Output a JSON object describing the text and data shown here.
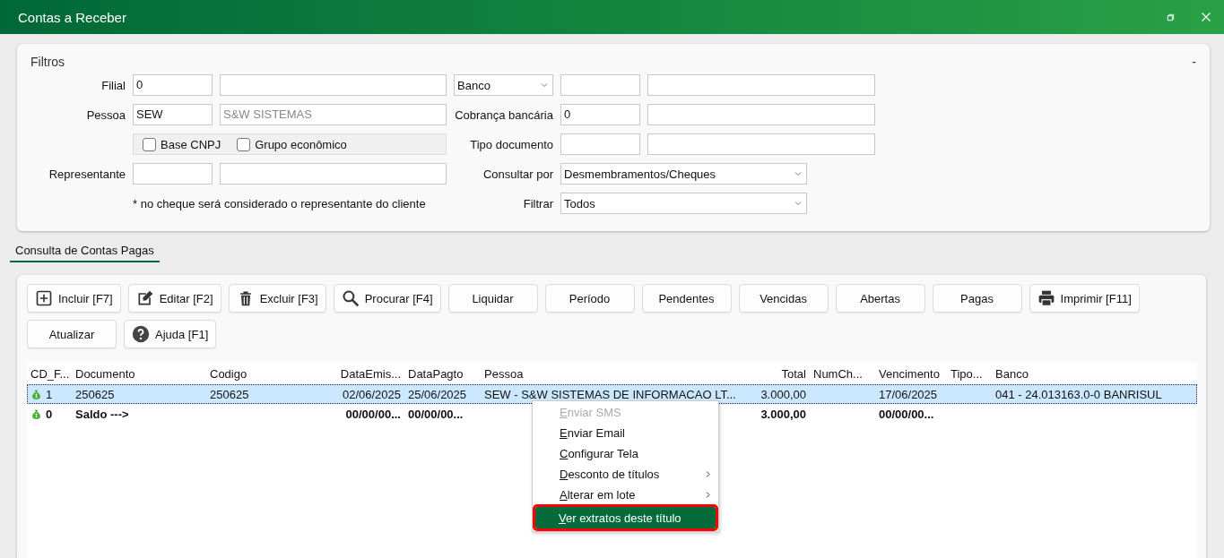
{
  "window": {
    "title": "Contas a Receber"
  },
  "filters": {
    "title": "Filtros",
    "collapse": "-",
    "left": [
      {
        "kind": "pair",
        "label": "Filial",
        "code": "0"
      },
      {
        "kind": "pair",
        "label": "Pessoa",
        "code": "SEW",
        "name": "S&W SISTEMAS",
        "name_readonly": true
      },
      {
        "kind": "checks",
        "items": [
          {
            "label": "Base CNPJ",
            "checked": false
          },
          {
            "label": "Grupo econômico",
            "checked": false
          }
        ]
      },
      {
        "kind": "pair",
        "label": "Representante"
      },
      {
        "kind": "note",
        "text": "* no cheque será considerado o representante do cliente"
      }
    ],
    "right": [
      {
        "kind": "select_pair",
        "value": "Banco"
      },
      {
        "kind": "pair",
        "label": "Cobrança bancária",
        "code": "0"
      },
      {
        "kind": "pair",
        "label": "Tipo documento"
      },
      {
        "kind": "select",
        "label": "Consultar por",
        "value": "Desmembramentos/Cheques"
      },
      {
        "kind": "select",
        "label": "Filtrar",
        "value": "Todos"
      }
    ]
  },
  "tab": {
    "label": "Consulta de Contas Pagas",
    "selected": true
  },
  "toolbar": [
    {
      "label": "Incluir [F7]",
      "kind": "add"
    },
    {
      "label": "Editar [F2]",
      "kind": "edit"
    },
    {
      "label": "Excluir [F3]",
      "kind": "delete"
    },
    {
      "label": "Procurar [F4]",
      "kind": "search"
    },
    {
      "label": "Liquidar",
      "kind": "plain"
    },
    {
      "label": "Período",
      "kind": "plain"
    },
    {
      "label": "Pendentes",
      "kind": "plain"
    },
    {
      "label": "Vencidas",
      "kind": "plain"
    },
    {
      "label": "Abertas",
      "kind": "plain"
    },
    {
      "label": "Pagas",
      "kind": "plain"
    },
    {
      "label": "Imprimir [F11]",
      "kind": "print"
    },
    {
      "label": "Atualizar",
      "kind": "plain"
    },
    {
      "label": "Ajuda [F1]",
      "kind": "help"
    }
  ],
  "table": {
    "columns": [
      "CD_F...",
      "Documento",
      "Codigo",
      "DataEmis...",
      "DataPagto",
      "Pessoa",
      "Total",
      "NumCh...",
      "Vencimento",
      "Tipo...",
      "Banco"
    ],
    "rows": [
      {
        "kind": "item",
        "selected": true,
        "cells": [
          "1",
          "250625",
          "250625",
          "02/06/2025",
          "25/06/2025",
          "SEW - S&W SISTEMAS DE INFORMACAO LT...",
          "3.000,00",
          null,
          "17/06/2025",
          null,
          "041 - 24.013163.0-0 BANRISUL"
        ]
      },
      {
        "kind": "total",
        "selected": false,
        "cells": [
          "0",
          "Saldo --->",
          null,
          "00/00/00...",
          "00/00/00...",
          null,
          "3.000,00",
          null,
          "00/00/00...",
          null,
          null
        ]
      }
    ]
  },
  "context_menu": [
    {
      "label": "Enviar SMS",
      "disabled": true,
      "submenu": false,
      "selected": false
    },
    {
      "label": "Enviar Email",
      "disabled": false,
      "submenu": false,
      "selected": false
    },
    {
      "label": "Configurar Tela",
      "disabled": false,
      "submenu": false,
      "selected": false
    },
    {
      "label": "Desconto de títulos",
      "disabled": false,
      "submenu": true,
      "selected": false
    },
    {
      "label": "Alterar em lote",
      "disabled": false,
      "submenu": true,
      "selected": false
    },
    {
      "label": "Ver extratos deste título",
      "disabled": false,
      "submenu": false,
      "selected": true
    }
  ]
}
